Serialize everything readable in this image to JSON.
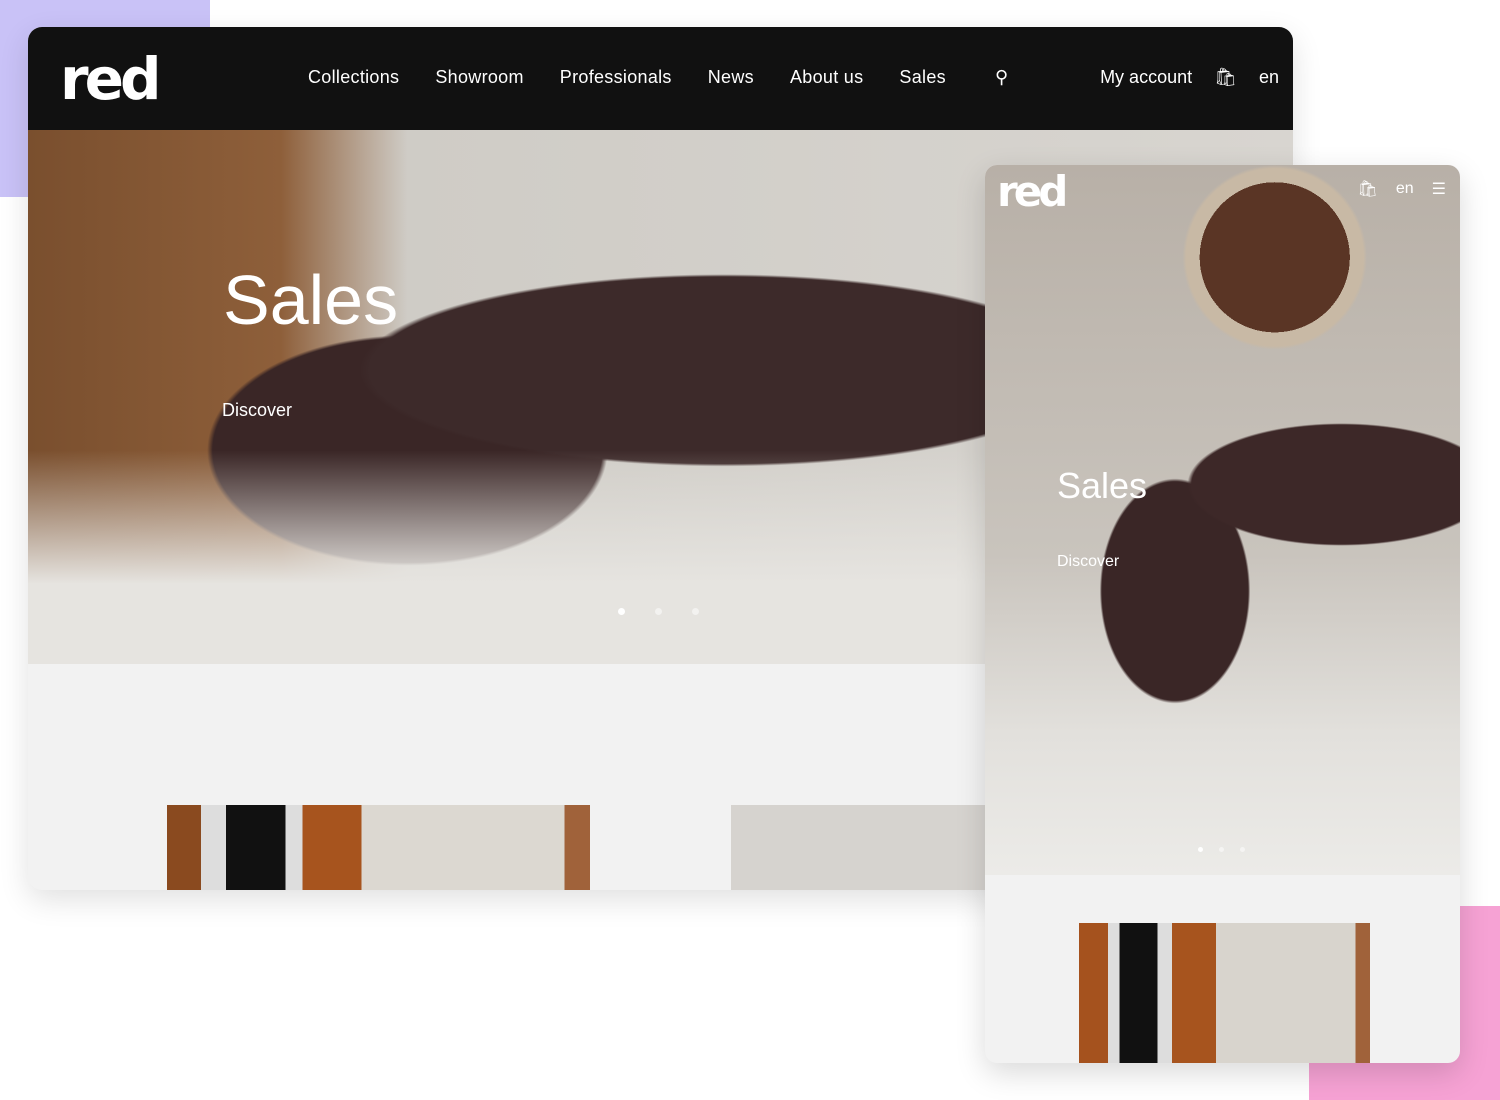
{
  "colors": {
    "nav_bg": "#111111",
    "accent_purple": "#c9c2f7",
    "accent_pink": "#f6a2d4",
    "page_bg": "#f2f2f2"
  },
  "desktop": {
    "logo": "red",
    "menu": [
      "Collections",
      "Showroom",
      "Professionals",
      "News",
      "About us",
      "Sales"
    ],
    "search_icon": "search-icon",
    "account": "My account",
    "cart_icon": "shopping-bag-icon",
    "language": "en",
    "hero": {
      "title": "Sales",
      "link": "Discover",
      "slides": 3,
      "active_slide": 1
    }
  },
  "mobile": {
    "logo": "red",
    "cart_icon": "shopping-bag-icon",
    "language": "en",
    "menu_icon": "hamburger-icon",
    "hero": {
      "title": "Sales",
      "link": "Discover",
      "slides": 3,
      "active_slide": 1
    }
  }
}
